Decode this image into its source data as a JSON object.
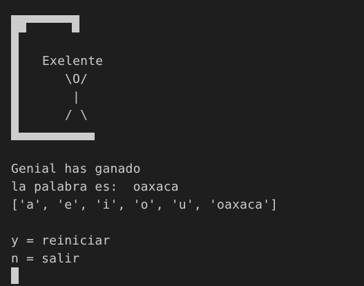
{
  "hangman": {
    "message": "Exelente",
    "head_arms": "\\O/",
    "body": "|",
    "legs": "/ \\"
  },
  "output": {
    "win_message": "Genial has ganado",
    "word_line": "la palabra es:  oaxaca",
    "guesses_line": "['a', 'e', 'i', 'o', 'u', 'oaxaca']",
    "restart_option": "y = reiniciar",
    "exit_option": "n = salir"
  }
}
